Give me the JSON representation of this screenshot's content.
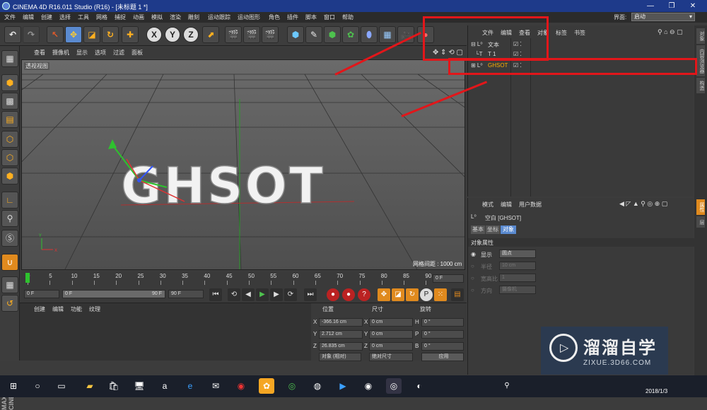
{
  "window": {
    "title": "CINEMA 4D R16.011 Studio (R16) - [未标题 1 *]",
    "controls": [
      "—",
      "❐",
      "✕"
    ]
  },
  "menubar": {
    "items": [
      "文件",
      "编辑",
      "创建",
      "选择",
      "工具",
      "网格",
      "捕捉",
      "动画",
      "模拟",
      "渲染",
      "雕刻",
      "运动跟踪",
      "运动图形",
      "角色",
      "插件",
      "脚本",
      "窗口",
      "帮助"
    ],
    "layout_label": "界面:",
    "layout_value": "启动"
  },
  "viewport": {
    "menu": [
      "查看",
      "摄像机",
      "显示",
      "选项",
      "过滤",
      "面板"
    ],
    "label": "透视视图",
    "grid_spacing": "网格间距 : 1000 cm",
    "text_object": "GHSOT"
  },
  "timeline": {
    "ticks": [
      "0",
      "5",
      "10",
      "15",
      "20",
      "25",
      "30",
      "35",
      "40",
      "45",
      "50",
      "55",
      "60",
      "65",
      "70",
      "75",
      "80",
      "85",
      "90"
    ],
    "current_frame": "0 F"
  },
  "transport": {
    "start": "0 F",
    "range_start": "0 F",
    "range_end": "90 F",
    "end": "90 F"
  },
  "material_panel": {
    "menu": [
      "创建",
      "编辑",
      "功能",
      "纹理"
    ]
  },
  "coord_panel": {
    "headers": [
      "位置",
      "尺寸",
      "旋转"
    ],
    "rows": [
      {
        "axis": "X",
        "pos": "-366.16 cm",
        "saxis": "X",
        "size": "0 cm",
        "raxis": "H",
        "rot": "0 °"
      },
      {
        "axis": "Y",
        "pos": "2.712 cm",
        "saxis": "Y",
        "size": "0 cm",
        "raxis": "P",
        "rot": "0 °"
      },
      {
        "axis": "Z",
        "pos": "26.835 cm",
        "saxis": "Z",
        "size": "0 cm",
        "raxis": "B",
        "rot": "0 °"
      }
    ],
    "mode": "对象 (相对)",
    "size_mode": "绝对尺寸",
    "apply": "应用"
  },
  "object_manager": {
    "menu": [
      "文件",
      "编辑",
      "查看",
      "对象",
      "标签",
      "书签"
    ],
    "objects": [
      {
        "name": "文本",
        "icon": "null-icon"
      },
      {
        "name": "T 1",
        "icon": "text-icon"
      },
      {
        "name": "GHSOT",
        "icon": "null-icon",
        "selected": true
      }
    ]
  },
  "attribute_manager": {
    "menu": [
      "模式",
      "编辑",
      "用户数据"
    ],
    "object_title": "空白 [GHSOT]",
    "tabs": [
      "基本",
      "坐标",
      "对象"
    ],
    "section": "对象属性",
    "props": [
      {
        "label": "显示",
        "value": "圆点",
        "enabled": true
      },
      {
        "label": "半径",
        "value": "10 cm",
        "enabled": false
      },
      {
        "label": "宽高比",
        "value": "1",
        "enabled": false
      },
      {
        "label": "方向",
        "value": "摄像机",
        "enabled": false
      }
    ]
  },
  "right_tabs": [
    "对象",
    "内容浏览器",
    "构造",
    "属性",
    "层"
  ],
  "watermark": {
    "title": "溜溜自学",
    "url": "ZIXUE.3D66.COM"
  },
  "taskbar": {
    "time": "2018/1/3"
  },
  "colors": {
    "accent": "#e08a1e",
    "selected_text": "#ffb000",
    "annotation": "#e2161a"
  }
}
